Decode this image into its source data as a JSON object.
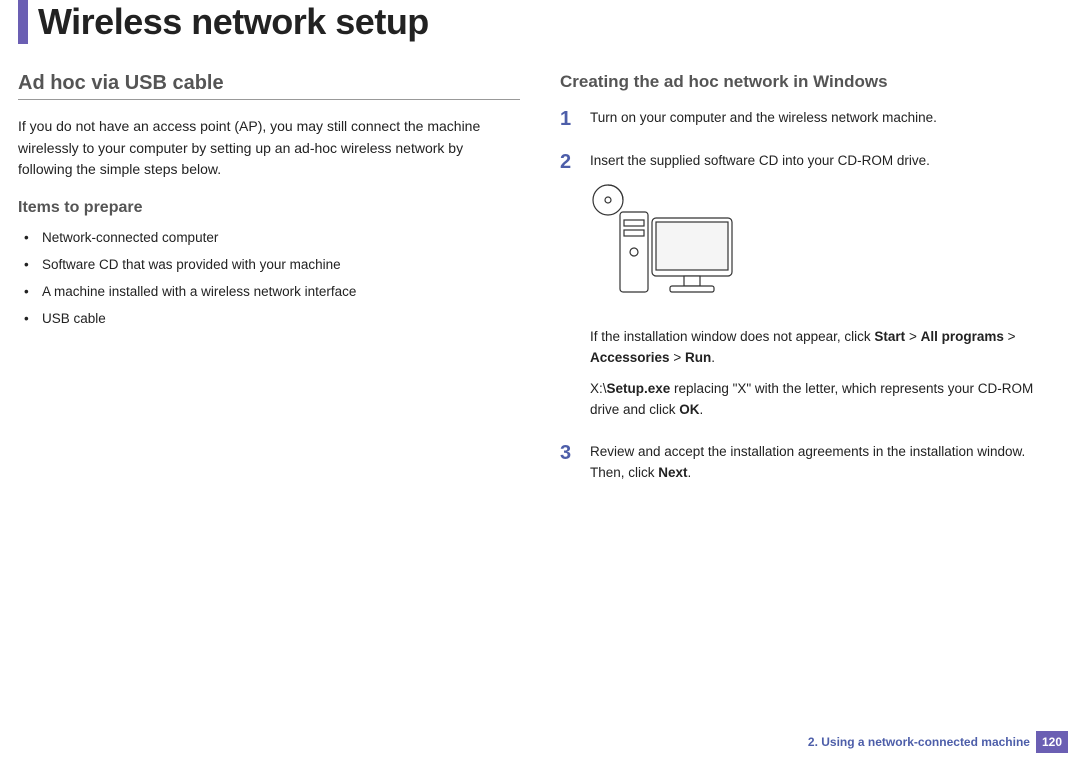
{
  "page_title": "Wireless network setup",
  "left": {
    "heading": "Ad hoc via USB cable",
    "intro": "If you do not have an access point (AP), you may still connect the machine wirelessly to your computer by setting up an ad-hoc wireless network by following the simple steps below.",
    "subheading": "Items to prepare",
    "items": [
      "Network-connected computer",
      "Software CD that was provided with your machine",
      "A machine installed with a wireless network interface",
      "USB cable"
    ]
  },
  "right": {
    "heading": "Creating the ad hoc network in Windows",
    "steps": [
      {
        "num": "1",
        "text": "Turn on your computer and the wireless network machine."
      },
      {
        "num": "2",
        "text": "Insert the supplied software CD into your CD-ROM drive.",
        "note_prefix": "If the installation window does not appear, click ",
        "note_bold1": "Start",
        "note_mid1": " > ",
        "note_bold2": "All programs",
        "note_mid2": " > ",
        "note_bold3": "Accessories",
        "note_mid3": " > ",
        "note_bold4": "Run",
        "note_suffix": ".",
        "path_prefix": " X:\\",
        "path_bold": "Setup.exe",
        "path_mid": " replacing \"X\" with the letter, which represents your CD-ROM drive and click ",
        "path_ok": "OK",
        "path_suffix": "."
      },
      {
        "num": "3",
        "text_prefix": "Review and accept the installation agreements in the installation window. Then, click ",
        "text_bold": "Next",
        "text_suffix": "."
      }
    ]
  },
  "footer": {
    "chapter": "2.  Using a network-connected machine",
    "page": "120"
  }
}
